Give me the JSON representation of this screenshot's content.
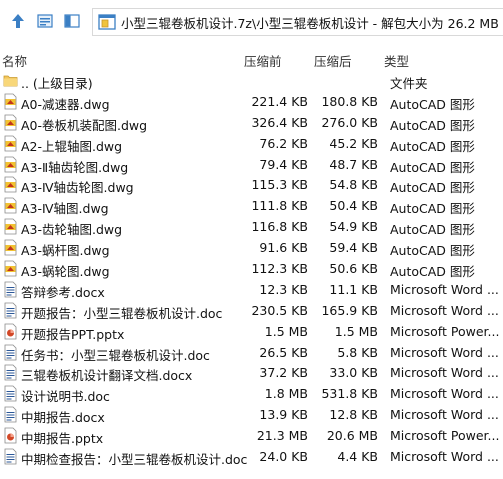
{
  "address": {
    "path": "小型三辊卷板机设计.7z\\小型三辊卷板机设计 - 解包大小为 26.2 MB"
  },
  "columns": {
    "name": "名称",
    "compressed": "压缩前",
    "original": "压缩后",
    "type": "类型"
  },
  "rows": [
    {
      "name": ".. (上级目录)",
      "comp": "",
      "orig": "",
      "type": "文件夹",
      "icon": "folder-icon"
    },
    {
      "name": "A0-减速器.dwg",
      "comp": "221.4 KB",
      "orig": "180.8 KB",
      "type": "AutoCAD 图形",
      "icon": "dwg-file-icon"
    },
    {
      "name": "A0-卷板机装配图.dwg",
      "comp": "326.4 KB",
      "orig": "276.0 KB",
      "type": "AutoCAD 图形",
      "icon": "dwg-file-icon"
    },
    {
      "name": "A2-上辊轴图.dwg",
      "comp": "76.2 KB",
      "orig": "45.2 KB",
      "type": "AutoCAD 图形",
      "icon": "dwg-file-icon"
    },
    {
      "name": "A3-Ⅱ轴齿轮图.dwg",
      "comp": "79.4 KB",
      "orig": "48.7 KB",
      "type": "AutoCAD 图形",
      "icon": "dwg-file-icon"
    },
    {
      "name": "A3-Ⅳ轴齿轮图.dwg",
      "comp": "115.3 KB",
      "orig": "54.8 KB",
      "type": "AutoCAD 图形",
      "icon": "dwg-file-icon"
    },
    {
      "name": "A3-Ⅳ轴图.dwg",
      "comp": "111.8 KB",
      "orig": "50.4 KB",
      "type": "AutoCAD 图形",
      "icon": "dwg-file-icon"
    },
    {
      "name": "A3-齿轮轴图.dwg",
      "comp": "116.8 KB",
      "orig": "54.9 KB",
      "type": "AutoCAD 图形",
      "icon": "dwg-file-icon"
    },
    {
      "name": "A3-蜗杆图.dwg",
      "comp": "91.6 KB",
      "orig": "59.4 KB",
      "type": "AutoCAD 图形",
      "icon": "dwg-file-icon"
    },
    {
      "name": "A3-蜗轮图.dwg",
      "comp": "112.3 KB",
      "orig": "50.6 KB",
      "type": "AutoCAD 图形",
      "icon": "dwg-file-icon"
    },
    {
      "name": "答辩参考.docx",
      "comp": "12.3 KB",
      "orig": "11.1 KB",
      "type": "Microsoft Word ...",
      "icon": "word-file-icon"
    },
    {
      "name": "开题报告：小型三辊卷板机设计.doc",
      "comp": "230.5 KB",
      "orig": "165.9 KB",
      "type": "Microsoft Word ...",
      "icon": "word-file-icon"
    },
    {
      "name": "开题报告PPT.pptx",
      "comp": "1.5 MB",
      "orig": "1.5 MB",
      "type": "Microsoft Power...",
      "icon": "ppt-file-icon"
    },
    {
      "name": "任务书：小型三辊卷板机设计.doc",
      "comp": "26.5 KB",
      "orig": "5.8 KB",
      "type": "Microsoft Word ...",
      "icon": "word-file-icon"
    },
    {
      "name": "三辊卷板机设计翻译文档.docx",
      "comp": "37.2 KB",
      "orig": "33.0 KB",
      "type": "Microsoft Word ...",
      "icon": "word-file-icon"
    },
    {
      "name": "设计说明书.doc",
      "comp": "1.8 MB",
      "orig": "531.8 KB",
      "type": "Microsoft Word ...",
      "icon": "word-file-icon"
    },
    {
      "name": "中期报告.docx",
      "comp": "13.9 KB",
      "orig": "12.8 KB",
      "type": "Microsoft Word ...",
      "icon": "word-file-icon"
    },
    {
      "name": "中期报告.pptx",
      "comp": "21.3 MB",
      "orig": "20.6 MB",
      "type": "Microsoft Power...",
      "icon": "ppt-file-icon"
    },
    {
      "name": "中期检查报告：小型三辊卷板机设计.doc",
      "comp": "24.0 KB",
      "orig": "4.4 KB",
      "type": "Microsoft Word ...",
      "icon": "word-file-icon"
    }
  ]
}
